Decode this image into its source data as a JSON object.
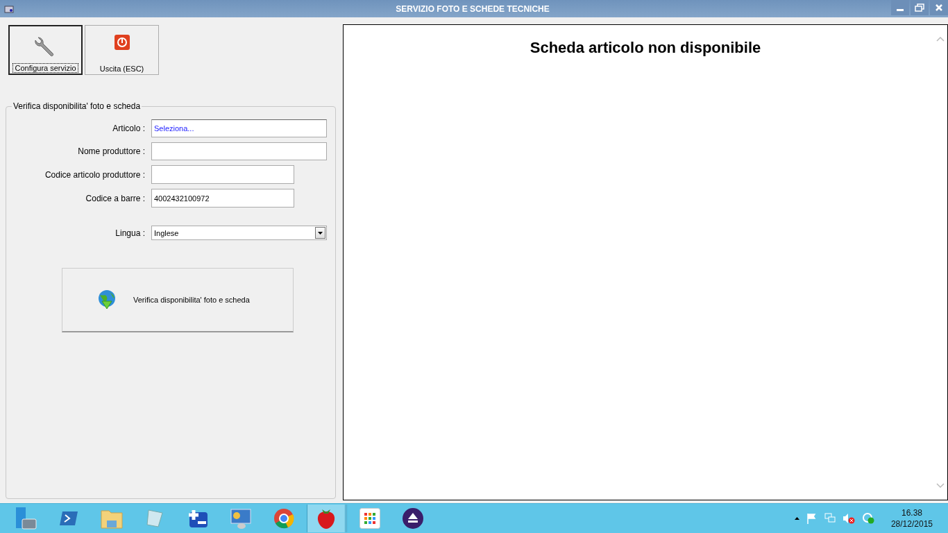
{
  "window": {
    "title": "SERVIZIO FOTO E SCHEDE TECNICHE"
  },
  "toolbar": [
    {
      "kind": "settings",
      "label": "Configura servizio",
      "focused": true
    },
    {
      "kind": "exit",
      "label": "Uscita (ESC)",
      "focused": false
    }
  ],
  "form": {
    "legend": "Verifica disponibilita' foto e scheda",
    "fields": [
      {
        "kind": "picker",
        "label": "Articolo :",
        "value": "Seleziona..."
      },
      {
        "kind": "text",
        "label": "Nome produttore :"
      },
      {
        "kind": "code",
        "label": "Codice articolo produttore :"
      },
      {
        "kind": "code",
        "label": "Codice a barre :",
        "value": "4002432100972"
      },
      {
        "kind": "dropdown",
        "label": "Lingua :",
        "value": "Inglese"
      }
    ],
    "action": "Verifica disponibilita' foto e scheda"
  },
  "viewer": {
    "heading": "Scheda articolo non disponibile"
  },
  "taskbar": {
    "apps": [
      {
        "kind": "server",
        "selected": false
      },
      {
        "kind": "shell",
        "selected": false
      },
      {
        "kind": "folder",
        "selected": false
      },
      {
        "kind": "notepad",
        "selected": false
      },
      {
        "kind": "plusminus",
        "selected": false
      },
      {
        "kind": "panel",
        "selected": false
      },
      {
        "kind": "browser",
        "selected": false
      },
      {
        "kind": "strawberry",
        "selected": true
      },
      {
        "kind": "grid",
        "selected": false
      },
      {
        "kind": "eject",
        "selected": false
      }
    ],
    "time": "16.38",
    "date": "28/12/2015"
  }
}
